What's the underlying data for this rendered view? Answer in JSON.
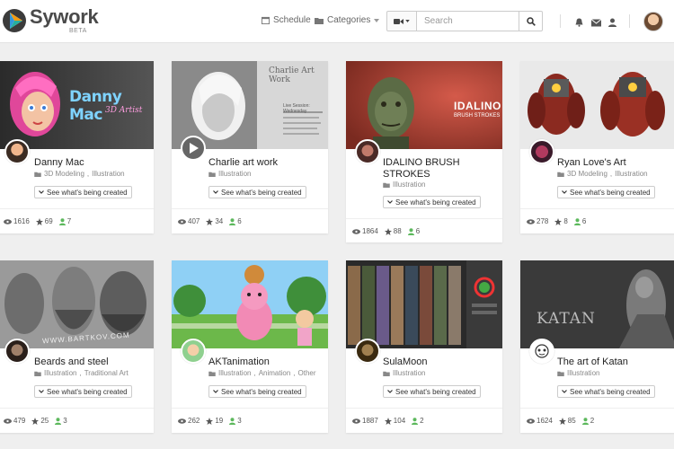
{
  "header": {
    "brand": "Sywork",
    "beta": "BETA",
    "schedule_label": "Schedule",
    "categories_label": "Categories",
    "search_placeholder": "Search",
    "icons": [
      "bell-icon",
      "envelope-icon",
      "user-icon"
    ]
  },
  "see_label": "See what's being created",
  "colors": {
    "accent_green": "#5cb85c",
    "logo_orange": "#f39c12",
    "logo_teal": "#27ae9e",
    "logo_blue": "#3498db"
  },
  "cards": [
    {
      "title": "Danny Mac",
      "categories": [
        "3D Modeling",
        "Illustration"
      ],
      "views": "1616",
      "stars": "69",
      "followers": "7"
    },
    {
      "title": "Charlie art work",
      "categories": [
        "Illustration"
      ],
      "views": "407",
      "stars": "34",
      "followers": "6",
      "thumb_text": [
        "Charlie Art Work",
        "Live Session: Wednesday"
      ]
    },
    {
      "title": "IDALINO BRUSH STROKES",
      "categories": [
        "Illustration"
      ],
      "views": "1864",
      "stars": "88",
      "followers": "6",
      "thumb_text": [
        "IDALINO",
        "BRUSH STROKES"
      ]
    },
    {
      "title": "Ryan Love's Art",
      "categories": [
        "3D Modeling",
        "Illustration"
      ],
      "views": "278",
      "stars": "8",
      "followers": "6"
    },
    {
      "title": "Beards and steel",
      "categories": [
        "Illustration",
        "Traditional Art"
      ],
      "views": "479",
      "stars": "25",
      "followers": "3",
      "thumb_text": [
        "WWW.BARTKOV.COM"
      ]
    },
    {
      "title": "AKTanimation",
      "categories": [
        "Illustration",
        "Animation",
        "Other"
      ],
      "views": "262",
      "stars": "19",
      "followers": "3"
    },
    {
      "title": "SulaMoon",
      "categories": [
        "Illustration"
      ],
      "views": "1887",
      "stars": "104",
      "followers": "2"
    },
    {
      "title": "The art of Katan",
      "categories": [
        "Illustration"
      ],
      "views": "1624",
      "stars": "85",
      "followers": "2",
      "thumb_text": [
        "KATAN"
      ]
    }
  ],
  "card1_logo": {
    "line1": "Danny Mac",
    "line2": "3D Artist"
  }
}
